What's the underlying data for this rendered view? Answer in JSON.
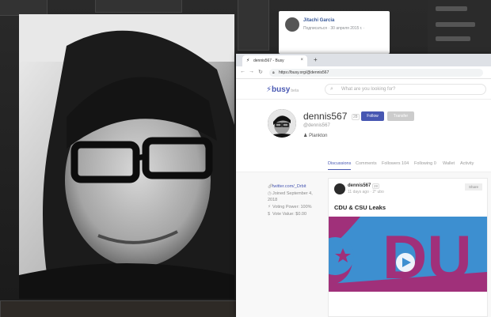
{
  "facebook_post": {
    "author": "Jitachi Garcia",
    "meta": "Подписаться · 30 апреля 2015 г. ·"
  },
  "browser": {
    "tab_title": "dennis567 - Busy",
    "url": "https://busy.org/@dennis567"
  },
  "site": {
    "logo": "busy",
    "logo_suffix": "beta",
    "search_placeholder": "What are you looking for?"
  },
  "profile": {
    "name": "dennis567",
    "reputation": "28",
    "handle": "@dennis567",
    "rank": "Plankton",
    "follow_label": "Follow",
    "transfer_label": "Transfer"
  },
  "tabs": [
    {
      "label": "Discussions",
      "active": true
    },
    {
      "label": "Comments"
    },
    {
      "label": "Followers 104"
    },
    {
      "label": "Following 0"
    },
    {
      "label": "Wallet"
    },
    {
      "label": "Activity"
    }
  ],
  "sidebar": {
    "website": "twitter.com/_Drbit",
    "joined_line1": "Joined September 4,",
    "joined_line2": "2018",
    "voting_power": "Voting Power: 100%",
    "vote_value": "Vote Value: $0.00"
  },
  "post": {
    "author": "dennis567",
    "reputation": "28",
    "time": "11 days ago · 2° ubo",
    "share_label": "Share",
    "title": "CDU & CSU Leaks",
    "image_text": "DU"
  },
  "colors": {
    "accent": "#4757b2",
    "post_image_blue": "#3d8fd0",
    "post_image_purple": "#a0307a"
  }
}
